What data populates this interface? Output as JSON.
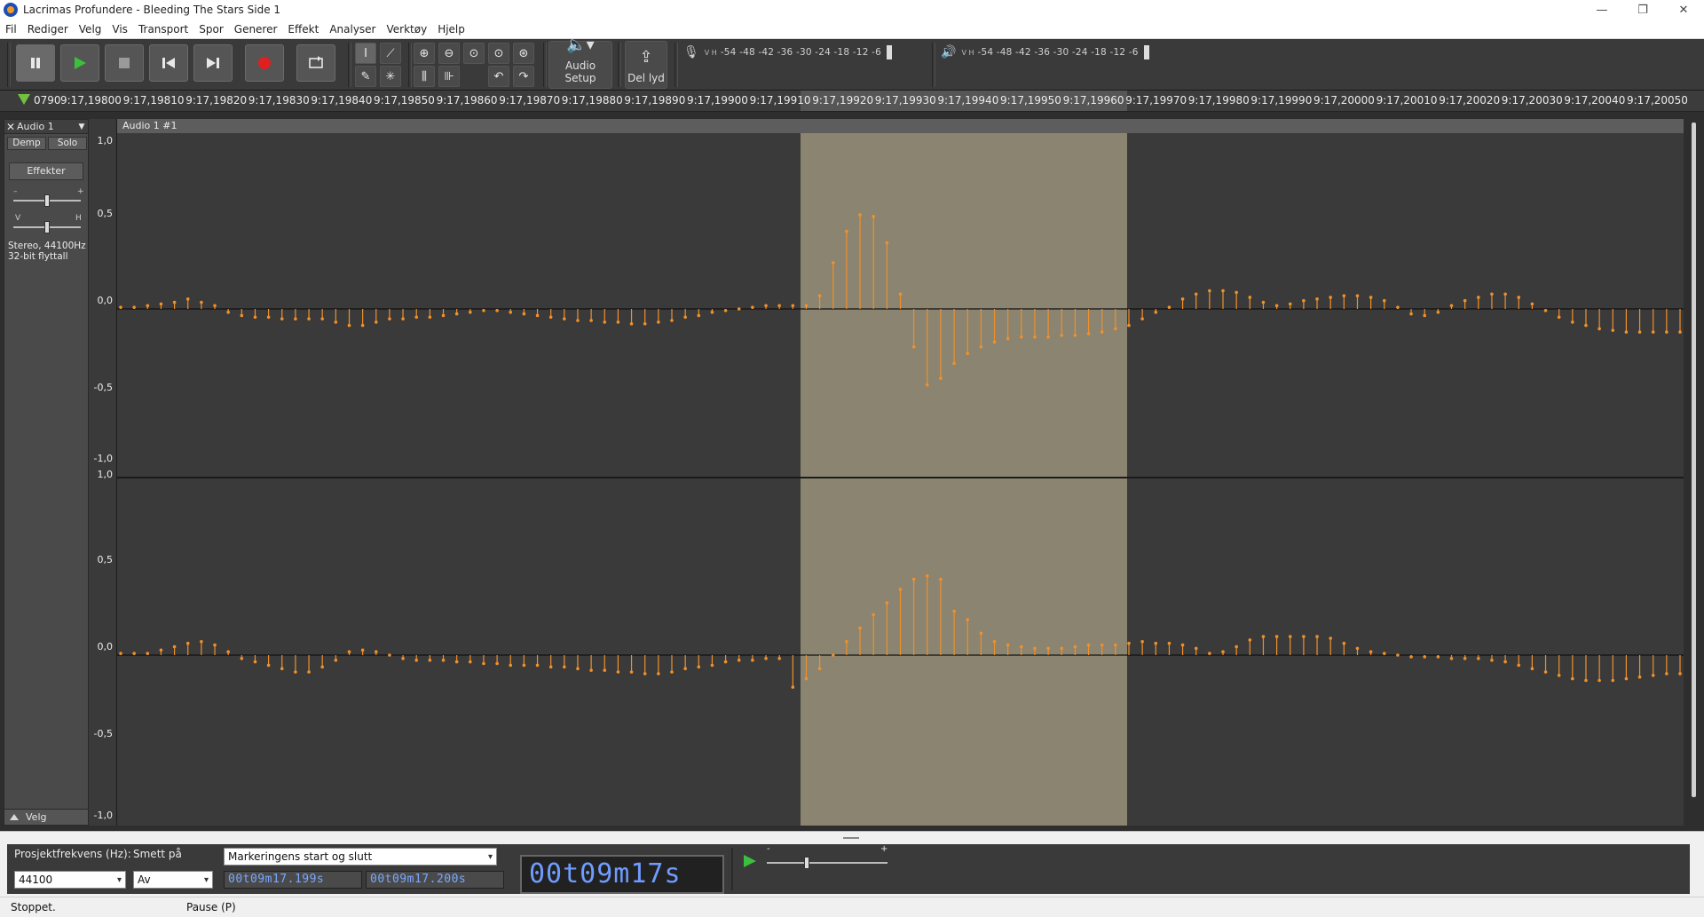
{
  "window": {
    "title": "Lacrimas Profundere - Bleeding The Stars Side 1",
    "minimize": "—",
    "maximize": "❐",
    "close": "✕"
  },
  "menubar": {
    "items": [
      "Fil",
      "Rediger",
      "Velg",
      "Vis",
      "Transport",
      "Spor",
      "Generer",
      "Effekt",
      "Analyser",
      "Verktøy",
      "Hjelp"
    ]
  },
  "toolbar": {
    "audio_setup_label": "Audio Setup",
    "share_label": "Del lyd",
    "record_meter_scale": "-54 -48 -42 -36 -30 -24 -18 -12 -6",
    "play_meter_scale": "-54 -48 -42 -36 -30 -24 -18 -12 -6",
    "meter_lr": "V H",
    "record_color": "#e02020",
    "play_color": "#3cbf3c"
  },
  "timeline": {
    "ticks": [
      "0790",
      "9:17,19800",
      "9:17,19810",
      "9:17,19820",
      "9:17,19830",
      "9:17,19840",
      "9:17,19850",
      "9:17,19860",
      "9:17,19870",
      "9:17,19880",
      "9:17,19890",
      "9:17,19900",
      "9:17,19910",
      "9:17,19920",
      "9:17,19930",
      "9:17,19940",
      "9:17,19950",
      "9:17,19960",
      "9:17,19970",
      "9:17,19980",
      "9:17,19990",
      "9:17,20000",
      "9:17,20010",
      "9:17,20020",
      "9:17,20030",
      "9:17,20040",
      "9:17,20050"
    ]
  },
  "track": {
    "name": "Audio 1",
    "mute_label": "Demp",
    "solo_label": "Solo",
    "effects_label": "Effekter",
    "gain_minus": "–",
    "gain_plus": "+",
    "pan_left": "V",
    "pan_right": "H",
    "info_line1": "Stereo, 44100Hz",
    "info_line2": "32-bit flyttall",
    "select_label": "Velg",
    "clip_name": "Audio 1 #1",
    "vscale": [
      "1,0",
      "0,5",
      "0,0",
      "-0,5",
      "-1,0"
    ],
    "sample_color": "#f0902a",
    "selection_color": "#8b8470",
    "top_channel_samples": [
      0.01,
      0.01,
      0.02,
      0.03,
      0.04,
      0.06,
      0.04,
      0.02,
      -0.02,
      -0.04,
      -0.05,
      -0.05,
      -0.06,
      -0.06,
      -0.06,
      -0.06,
      -0.08,
      -0.1,
      -0.1,
      -0.08,
      -0.06,
      -0.06,
      -0.05,
      -0.05,
      -0.04,
      -0.03,
      -0.02,
      -0.01,
      -0.01,
      -0.02,
      -0.03,
      -0.04,
      -0.05,
      -0.06,
      -0.07,
      -0.07,
      -0.08,
      -0.08,
      -0.09,
      -0.09,
      -0.08,
      -0.07,
      -0.05,
      -0.04,
      -0.02,
      -0.01,
      0.0,
      0.01,
      0.02,
      0.02,
      0.02,
      0.02,
      0.08,
      0.28,
      0.47,
      0.57,
      0.56,
      0.4,
      0.09,
      -0.23,
      -0.46,
      -0.42,
      -0.33,
      -0.27,
      -0.23,
      -0.2,
      -0.18,
      -0.17,
      -0.17,
      -0.17,
      -0.16,
      -0.16,
      -0.15,
      -0.14,
      -0.12,
      -0.1,
      -0.06,
      -0.02,
      0.01,
      0.06,
      0.09,
      0.11,
      0.11,
      0.1,
      0.07,
      0.04,
      0.02,
      0.03,
      0.05,
      0.06,
      0.07,
      0.08,
      0.08,
      0.07,
      0.05,
      0.01,
      -0.03,
      -0.04,
      -0.02,
      0.02,
      0.05,
      0.07,
      0.09,
      0.09,
      0.07,
      0.03,
      -0.01,
      -0.05,
      -0.08,
      -0.1,
      -0.12,
      -0.13,
      -0.14,
      -0.14,
      -0.14,
      -0.14,
      -0.14
    ],
    "bottom_channel_samples": [
      0.01,
      0.01,
      0.01,
      0.03,
      0.05,
      0.07,
      0.08,
      0.06,
      0.02,
      -0.02,
      -0.04,
      -0.06,
      -0.08,
      -0.1,
      -0.1,
      -0.07,
      -0.03,
      0.02,
      0.03,
      0.02,
      0.0,
      -0.02,
      -0.03,
      -0.03,
      -0.03,
      -0.04,
      -0.04,
      -0.05,
      -0.05,
      -0.06,
      -0.06,
      -0.06,
      -0.07,
      -0.07,
      -0.08,
      -0.09,
      -0.09,
      -0.1,
      -0.1,
      -0.11,
      -0.11,
      -0.1,
      -0.08,
      -0.07,
      -0.06,
      -0.04,
      -0.03,
      -0.03,
      -0.02,
      -0.02,
      -0.19,
      -0.14,
      -0.08,
      0.0,
      0.08,
      0.16,
      0.24,
      0.31,
      0.39,
      0.45,
      0.47,
      0.45,
      0.26,
      0.21,
      0.13,
      0.08,
      0.06,
      0.05,
      0.04,
      0.04,
      0.04,
      0.05,
      0.06,
      0.06,
      0.06,
      0.07,
      0.08,
      0.07,
      0.07,
      0.06,
      0.04,
      0.01,
      0.02,
      0.05,
      0.09,
      0.11,
      0.11,
      0.11,
      0.11,
      0.11,
      0.1,
      0.07,
      0.04,
      0.02,
      0.01,
      0.0,
      -0.01,
      -0.01,
      -0.01,
      -0.02,
      -0.02,
      -0.02,
      -0.03,
      -0.04,
      -0.06,
      -0.08,
      -0.1,
      -0.12,
      -0.14,
      -0.15,
      -0.15,
      -0.15,
      -0.14,
      -0.13,
      -0.12,
      -0.11,
      -0.11
    ]
  },
  "selection_bar": {
    "project_rate_label": "Prosjektfrekvens (Hz):",
    "project_rate_value": "44100",
    "snap_label": "Smett på",
    "snap_value": "Av",
    "mode_value": "Markeringens start og slutt",
    "start_time": "00t09m17.199s",
    "end_time": "00t09m17.200s",
    "big_time": "00t09m17s",
    "slider_minus": "-",
    "slider_plus": "+"
  },
  "status": {
    "state": "Stoppet.",
    "hint": "Pause (P)"
  }
}
